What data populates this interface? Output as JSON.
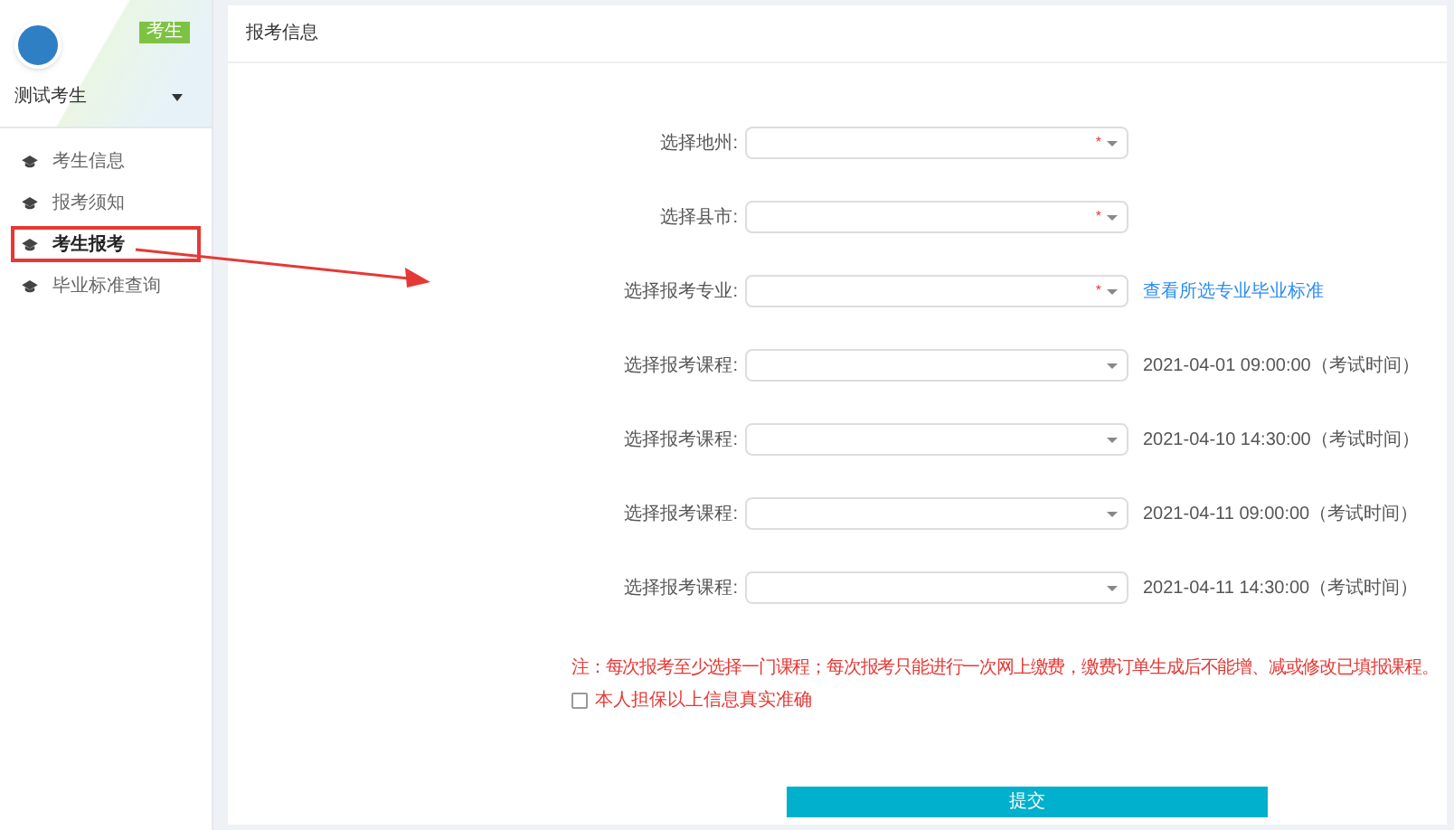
{
  "sidebar": {
    "role_badge": "考生",
    "user_name": "测试考生",
    "items": [
      {
        "label": "考生信息",
        "selected": false
      },
      {
        "label": "报考须知",
        "selected": false
      },
      {
        "label": "考生报考",
        "selected": true
      },
      {
        "label": "毕业标准查询",
        "selected": false
      }
    ]
  },
  "panel": {
    "title": "报考信息",
    "fields": [
      {
        "label": "选择地州:",
        "required_mark": "*"
      },
      {
        "label": "选择县市:",
        "required_mark": "*"
      },
      {
        "label": "选择报考专业:",
        "required_mark": "*",
        "link": "查看所选专业毕业标准"
      },
      {
        "label": "选择报考课程:",
        "exam_time": "2021-04-01 09:00:00（考试时间）"
      },
      {
        "label": "选择报考课程:",
        "exam_time": "2021-04-10 14:30:00（考试时间）"
      },
      {
        "label": "选择报考课程:",
        "exam_time": "2021-04-11 09:00:00（考试时间）"
      },
      {
        "label": "选择报考课程:",
        "exam_time": "2021-04-11 14:30:00（考试时间）"
      }
    ],
    "notice": "注：每次报考至少选择一门课程；每次报考只能进行一次网上缴费，缴费订单生成后不能增、减或修改已填报课程。",
    "pledge": {
      "label": "本人担保以上信息真实准确",
      "checked": false
    },
    "submit": "提交"
  }
}
